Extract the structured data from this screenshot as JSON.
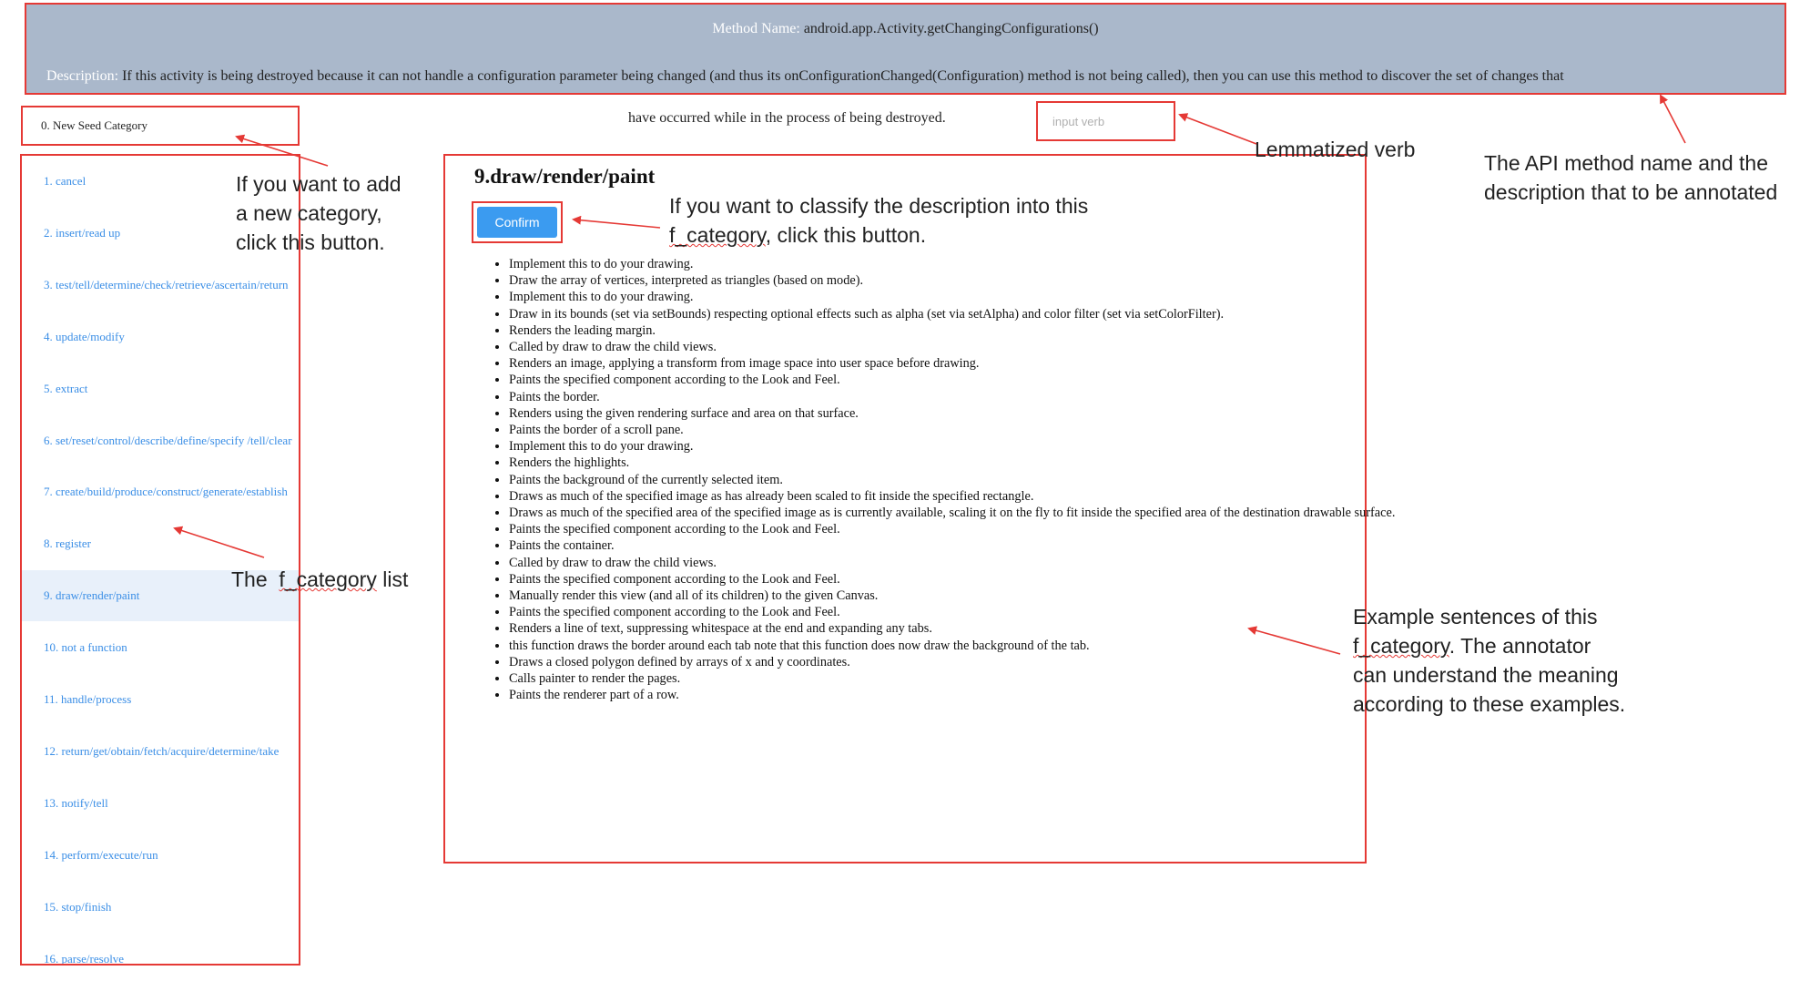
{
  "header": {
    "method_key": "Method Name:",
    "method_value": "android.app.Activity.getChangingConfigurations()",
    "description_key": "Description:",
    "description_value": "If this activity is being destroyed because it can not handle a configuration parameter being changed (and thus its onConfigurationChanged(Configuration) method is not being called), then you can use this method to discover the set of changes that",
    "description_cont": "have occurred while in the process of being destroyed."
  },
  "verb_input": {
    "placeholder": "input verb"
  },
  "sidebar": {
    "new_seed": "0. New Seed Category",
    "items": [
      {
        "label": "1. cancel"
      },
      {
        "label": "2. insert/read up"
      },
      {
        "label": "3. test/tell/determine/check/retrieve/ascertain/return"
      },
      {
        "label": "4. update/modify"
      },
      {
        "label": "5. extract"
      },
      {
        "label": "6. set/reset/control/describe/define/specify /tell/clear"
      },
      {
        "label": "7. create/build/produce/construct/generate/establish"
      },
      {
        "label": "8. register"
      },
      {
        "label": "9. draw/render/paint",
        "active": true
      },
      {
        "label": "10. not a function"
      },
      {
        "label": "11. handle/process"
      },
      {
        "label": "12. return/get/obtain/fetch/acquire/determine/take"
      },
      {
        "label": "13. notify/tell"
      },
      {
        "label": "14. perform/execute/run"
      },
      {
        "label": "15. stop/finish"
      },
      {
        "label": "16. parse/resolve"
      }
    ]
  },
  "main": {
    "title": "9.draw/render/paint",
    "confirm_label": "Confirm",
    "examples": [
      "Implement this to do your drawing.",
      "Draw the array of vertices, interpreted as triangles (based on mode).",
      "Implement this to do your drawing.",
      "Draw in its bounds (set via setBounds) respecting optional effects such as alpha (set via setAlpha) and color filter (set via setColorFilter).",
      "Renders the leading margin.",
      "Called by draw to draw the child views.",
      "Renders an image, applying a transform from image space into user space before drawing.",
      "Paints the specified component according to the Look and Feel.",
      "Paints the border.",
      "Renders using the given rendering surface and area on that surface.",
      "Paints the border of a scroll pane.",
      "Implement this to do your drawing.",
      "Renders the highlights.",
      "Paints the background of the currently selected item.",
      "Draws as much of the specified image as has already been scaled to fit inside the specified rectangle.",
      "Draws as much of the specified area of the specified image as is currently available, scaling it on the fly to fit inside the specified area of the destination drawable surface.",
      "Paints the specified component according to the Look and Feel.",
      "Paints the container.",
      "Called by draw to draw the child views.",
      "Paints the specified component according to the Look and Feel.",
      "Manually render this view (and all of its children) to the given Canvas.",
      "Paints the specified component according to the Look and Feel.",
      "Renders a line of text, suppressing whitespace at the end and expanding any tabs.",
      "this function draws the border around each tab note that this function does now draw the background of the tab.",
      "Draws a closed polygon defined by arrays of x and y coordinates.",
      "Calls painter to render the pages.",
      "Paints the renderer part of a row."
    ]
  },
  "annotations": {
    "new_category_note": [
      "If you want to add",
      "a new category,",
      "click this button."
    ],
    "lemmatized_verb": "Lemmatized verb",
    "api_note": [
      "The API method name and the",
      "description that to be annotated"
    ],
    "confirm_note_1": "If you want to classify the description into this",
    "confirm_note_2a": "f_category",
    "confirm_note_2b": ", click this button.",
    "category_list_a": "The  ",
    "category_list_b": "f_category",
    "category_list_c": " list",
    "examples_note_1": "Example sentences of this",
    "examples_note_2a": "f_category",
    "examples_note_2b": ". The annotator",
    "examples_note_3": "can understand the meaning",
    "examples_note_4": "according to these examples."
  },
  "colors": {
    "header_bg": "#aab8cb",
    "highlight_box": "#e53935",
    "link": "#3a8ee6",
    "confirm_bg": "#3b9bf0"
  }
}
